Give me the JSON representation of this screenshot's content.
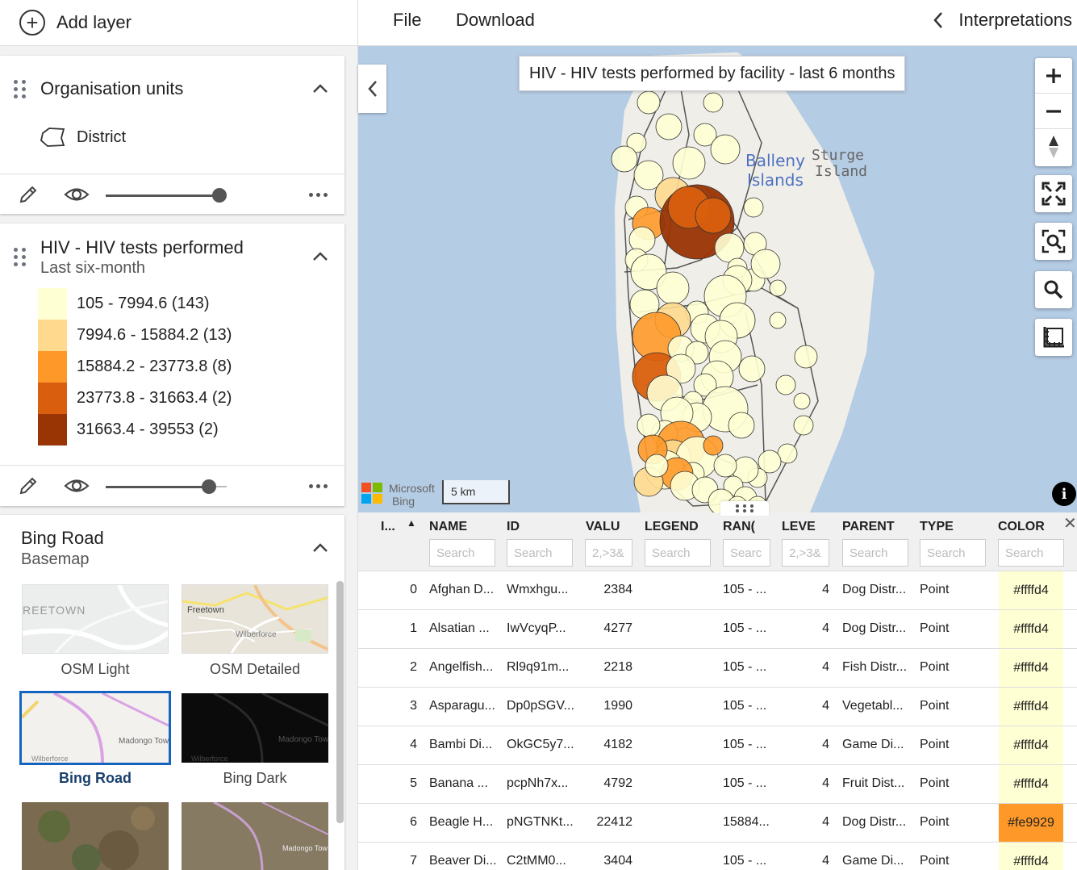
{
  "topbar": {
    "add_layer": "Add layer",
    "menu_file": "File",
    "menu_download": "Download",
    "interpretations": "Interpretations"
  },
  "layers": {
    "org_units": {
      "title": "Organisation units",
      "legend_item": "District"
    },
    "hiv": {
      "title": "HIV - HIV tests performed",
      "subtitle": "Last six-month",
      "legend": [
        {
          "label": "105 - 7994.6 (143)",
          "color": "#ffffd4"
        },
        {
          "label": "7994.6 - 15884.2 (13)",
          "color": "#fed98e"
        },
        {
          "label": "15884.2 - 23773.8 (8)",
          "color": "#fe9929"
        },
        {
          "label": "23773.8 - 31663.4 (2)",
          "color": "#d95f0e"
        },
        {
          "label": "31663.4 - 39553 (2)",
          "color": "#993404"
        }
      ]
    },
    "basemap": {
      "title": "Bing Road",
      "subtitle": "Basemap",
      "options": [
        "OSM Light",
        "OSM Detailed",
        "Bing Road",
        "Bing Dark"
      ],
      "selected": "Bing Road"
    }
  },
  "map": {
    "title": "HIV - HIV tests performed by facility - last 6 months",
    "place_label_1a": "Balleny",
    "place_label_1b": "Islands",
    "place_label_2a": "Sturge",
    "place_label_2b": "Island",
    "attribution_1": "Microsoft",
    "attribution_2": "Bing",
    "scale": "5 km",
    "info_glyph": "i"
  },
  "table": {
    "columns": [
      "I...",
      "NAME",
      "ID",
      "VALU",
      "LEGEND",
      "RAN(",
      "LEVE",
      "PARENT",
      "TYPE",
      "COLOR"
    ],
    "filters": [
      "",
      "Search",
      "Search",
      "2,>3&",
      "Search",
      "Searc",
      "2,>3&",
      "Search",
      "Search",
      "Search"
    ],
    "rows": [
      {
        "index": "0",
        "name": "Afghan D...",
        "id": "Wmxhgu...",
        "value": "2384",
        "range": "105 - ...",
        "level": "4",
        "parent": "Dog Distr...",
        "type": "Point",
        "color": "#ffffd4"
      },
      {
        "index": "1",
        "name": "Alsatian ...",
        "id": "IwVcyqP...",
        "value": "4277",
        "range": "105 - ...",
        "level": "4",
        "parent": "Dog Distr...",
        "type": "Point",
        "color": "#ffffd4"
      },
      {
        "index": "2",
        "name": "Angelfish...",
        "id": "Rl9q91m...",
        "value": "2218",
        "range": "105 - ...",
        "level": "4",
        "parent": "Fish Distr...",
        "type": "Point",
        "color": "#ffffd4"
      },
      {
        "index": "3",
        "name": "Asparagu...",
        "id": "Dp0pSGV...",
        "value": "1990",
        "range": "105 - ...",
        "level": "4",
        "parent": "Vegetabl...",
        "type": "Point",
        "color": "#ffffd4"
      },
      {
        "index": "4",
        "name": "Bambi Di...",
        "id": "OkGC5y7...",
        "value": "4182",
        "range": "105 - ...",
        "level": "4",
        "parent": "Game Di...",
        "type": "Point",
        "color": "#ffffd4"
      },
      {
        "index": "5",
        "name": "Banana ...",
        "id": "pcpNh7x...",
        "value": "4792",
        "range": "105 - ...",
        "level": "4",
        "parent": "Fruit Dist...",
        "type": "Point",
        "color": "#ffffd4"
      },
      {
        "index": "6",
        "name": "Beagle H...",
        "id": "pNGTNKt...",
        "value": "22412",
        "range": "15884...",
        "level": "4",
        "parent": "Dog Distr...",
        "type": "Point",
        "color": "#fe9929"
      },
      {
        "index": "7",
        "name": "Beaver Di...",
        "id": "C2tMM0...",
        "value": "3404",
        "range": "105 - ...",
        "level": "4",
        "parent": "Game Di...",
        "type": "Point",
        "color": "#ffffd4"
      }
    ]
  }
}
